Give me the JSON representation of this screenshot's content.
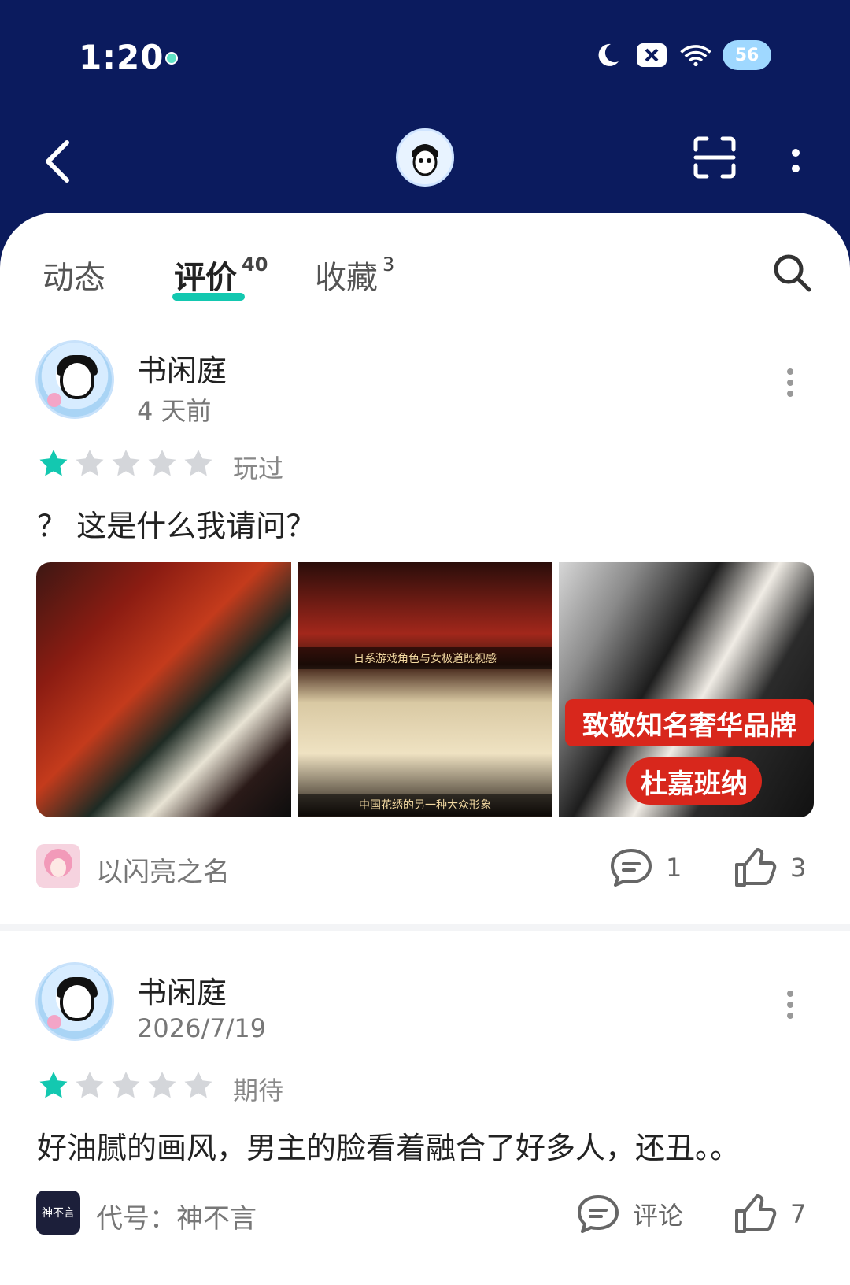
{
  "status_bar": {
    "time": "1:20",
    "battery": "56"
  },
  "colors": {
    "header_bg": "#0b1b5e",
    "accent": "#13c8b0",
    "star_filled": "#13c8b0",
    "star_empty": "#d4d6da"
  },
  "tabs": [
    {
      "label": "动态",
      "count": ""
    },
    {
      "label": "评价",
      "count": "40"
    },
    {
      "label": "收藏",
      "count": "3"
    }
  ],
  "reviews": [
    {
      "username": "书闲庭",
      "date": "4 天前",
      "rating": 1,
      "status_label": "玩过",
      "text": "？ 这是什么我请问？",
      "image_texts": [
        "致敬知名奢华品牌",
        "杜嘉班纳",
        "日系游戏角色与女极道既视感",
        "中国花绣的另一种大众形象"
      ],
      "game_name": "以闪亮之名",
      "comment_count": "1",
      "like_count": "3"
    },
    {
      "username": "书闲庭",
      "date": "2026/7/19",
      "rating": 1,
      "status_label": "期待",
      "text": "好油腻的画风，男主的脸看着融合了好多人，还丑。。",
      "game_name": "代号：神不言",
      "game_icon_text": "神不言",
      "comment_label": "评论",
      "like_count": "7"
    }
  ]
}
